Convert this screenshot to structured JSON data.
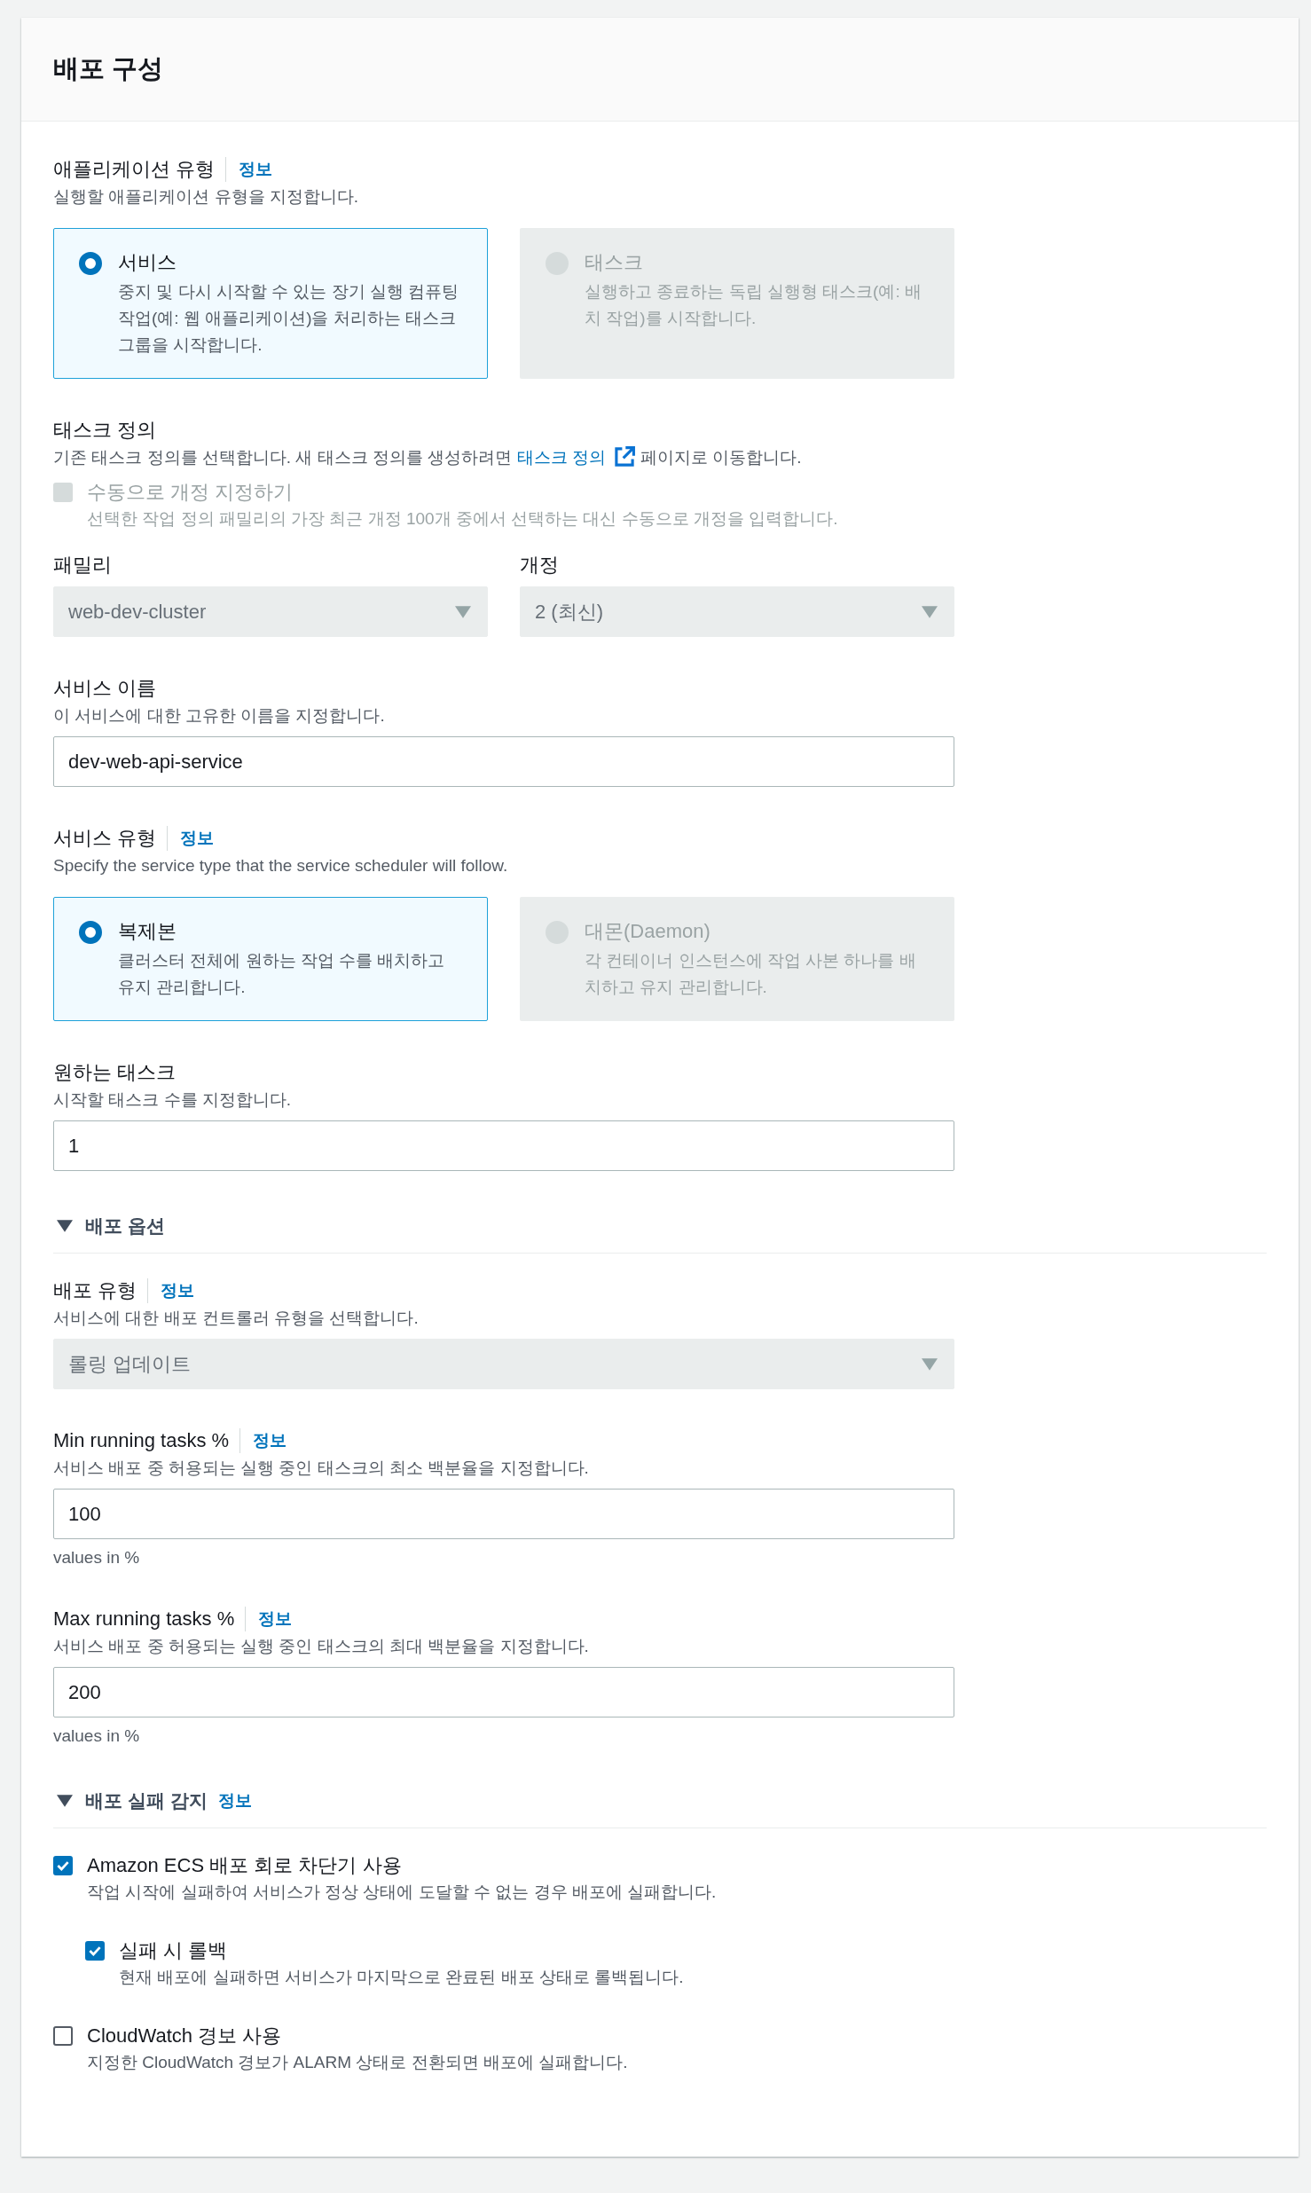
{
  "panel": {
    "title": "배포 구성"
  },
  "application_type": {
    "label": "애플리케이션 유형",
    "info": "정보",
    "description": "실행할 애플리케이션 유형을 지정합니다.",
    "options": [
      {
        "title": "서비스",
        "description": "중지 및 다시 시작할 수 있는 장기 실행 컴퓨팅 작업(예: 웹 애플리케이션)을 처리하는 태스크 그룹을 시작합니다.",
        "selected": true,
        "disabled": false
      },
      {
        "title": "태스크",
        "description": "실행하고 종료하는 독립 실행형 태스크(예: 배치 작업)를 시작합니다.",
        "selected": false,
        "disabled": true
      }
    ]
  },
  "task_definition": {
    "label": "태스크 정의",
    "description_before": "기존 태스크 정의를 선택합니다. 새 태스크 정의를 생성하려면",
    "link": "태스크 정의",
    "description_after": "페이지로 이동합니다.",
    "manual_revision": {
      "label": "수동으로 개정 지정하기",
      "description": "선택한 작업 정의 패밀리의 가장 최근 개정 100개 중에서 선택하는 대신 수동으로 개정을 입력합니다.",
      "checked": false,
      "disabled": true
    },
    "family": {
      "label": "패밀리",
      "value": "web-dev-cluster",
      "disabled": true
    },
    "revision": {
      "label": "개정",
      "value": "2 (최신)",
      "disabled": true
    }
  },
  "service_name": {
    "label": "서비스 이름",
    "description": "이 서비스에 대한 고유한 이름을 지정합니다.",
    "value": "dev-web-api-service"
  },
  "service_type": {
    "label": "서비스 유형",
    "info": "정보",
    "description": "Specify the service type that the service scheduler will follow.",
    "options": [
      {
        "title": "복제본",
        "description": "클러스터 전체에 원하는 작업 수를 배치하고 유지 관리합니다.",
        "selected": true,
        "disabled": false
      },
      {
        "title": "대몬(Daemon)",
        "description": "각 컨테이너 인스턴스에 작업 사본 하나를 배치하고 유지 관리합니다.",
        "selected": false,
        "disabled": true
      }
    ]
  },
  "desired_tasks": {
    "label": "원하는 태스크",
    "description": "시작할 태스크 수를 지정합니다.",
    "value": "1"
  },
  "deployment_options": {
    "title": "배포 옵션",
    "expanded": true,
    "deployment_type": {
      "label": "배포 유형",
      "info": "정보",
      "description": "서비스에 대한 배포 컨트롤러 유형을 선택합니다.",
      "value": "롤링 업데이트",
      "disabled": true
    },
    "min_running": {
      "label": "Min running tasks %",
      "info": "정보",
      "description": "서비스 배포 중 허용되는 실행 중인 태스크의 최소 백분율을 지정합니다.",
      "value": "100",
      "hint": "values in %"
    },
    "max_running": {
      "label": "Max running tasks %",
      "info": "정보",
      "description": "서비스 배포 중 허용되는 실행 중인 태스크의 최대 백분율을 지정합니다.",
      "value": "200",
      "hint": "values in %"
    }
  },
  "failure_detection": {
    "title": "배포 실패 감지",
    "info": "정보",
    "expanded": true,
    "checkboxes": [
      {
        "label": "Amazon ECS 배포 회로 차단기 사용",
        "description": "작업 시작에 실패하여 서비스가 정상 상태에 도달할 수 없는 경우 배포에 실패합니다.",
        "checked": true,
        "children": [
          {
            "label": "실패 시 롤백",
            "description": "현재 배포에 실패하면 서비스가 마지막으로 완료된 배포 상태로 롤백됩니다.",
            "checked": true
          }
        ]
      },
      {
        "label": "CloudWatch 경보 사용",
        "description": "지정한 CloudWatch 경보가 ALARM 상태로 전환되면 배포에 실패합니다.",
        "checked": false
      }
    ]
  }
}
